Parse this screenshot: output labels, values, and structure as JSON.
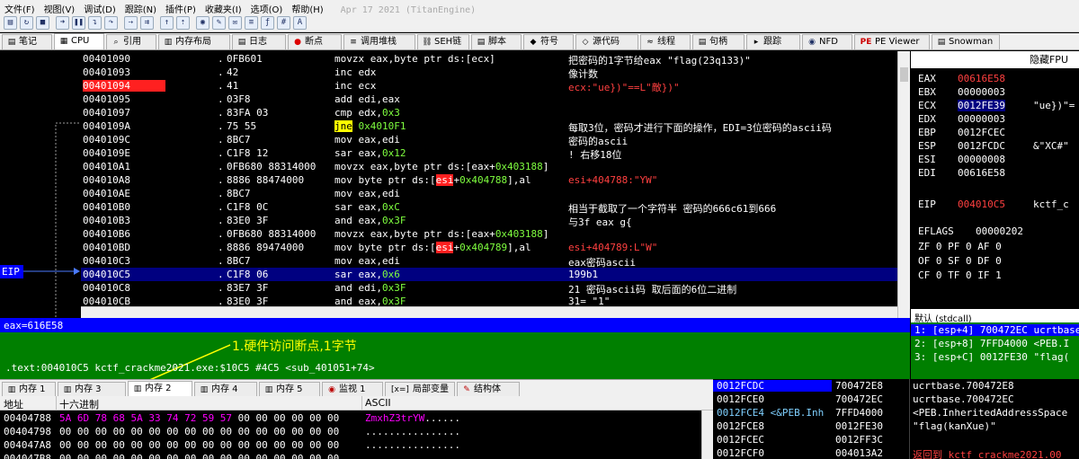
{
  "menu": [
    "文件(F)",
    "视图(V)",
    "调试(D)",
    "跟踪(N)",
    "插件(P)",
    "收藏夹(I)",
    "选项(O)",
    "帮助(H)",
    "Apr 17 2021 (TitanEngine)"
  ],
  "toolbar_icons": [
    "open-icon",
    "restart-icon",
    "close-icon",
    "run-icon",
    "pause-icon",
    "step-into-icon",
    "step-over-icon",
    "trace-into-icon",
    "trace-over-icon",
    "run-to-user-icon",
    "run-to-return-icon",
    "hide-icon",
    "patch-icon",
    "comment-icon",
    "label-icon",
    "function-icon",
    "hash-icon",
    "font-icon"
  ],
  "tabs": [
    {
      "label": "笔记",
      "icon": "▤"
    },
    {
      "label": "CPU",
      "icon": "▦"
    },
    {
      "label": "引用",
      "icon": "⌕"
    },
    {
      "label": "内存布局",
      "icon": "▥"
    },
    {
      "label": "日志",
      "icon": "▤"
    },
    {
      "label": "断点",
      "icon": "●"
    },
    {
      "label": "调用堆栈",
      "icon": "≡"
    },
    {
      "label": "SEH链",
      "icon": "⛓"
    },
    {
      "label": "脚本",
      "icon": "▤"
    },
    {
      "label": "符号",
      "icon": "◆"
    },
    {
      "label": "源代码",
      "icon": "◇"
    },
    {
      "label": "线程",
      "icon": "≈"
    },
    {
      "label": "句柄",
      "icon": "▤"
    },
    {
      "label": "跟踪",
      "icon": "▸"
    },
    {
      "label": "NFD",
      "icon": "◉"
    },
    {
      "label": "PE Viewer",
      "icon": "PE"
    },
    {
      "label": "Snowman",
      "icon": "▤"
    }
  ],
  "gutter": {
    "eip_label": "EIP"
  },
  "disasm": [
    {
      "addr": "00401090",
      "dot": ".",
      "hex": "0FB601",
      "asm": "movzx eax,byte ptr ds:[ecx]",
      "comment": "把密码的1字节给eax \"flag(23q133)\""
    },
    {
      "addr": "00401093",
      "dot": ".",
      "hex": "42",
      "asm": "inc edx",
      "comment": "像计数"
    },
    {
      "addr": "00401094",
      "dot": ".",
      "hex": "41",
      "asm": "inc ecx",
      "comment": "ecx:\"ue})\"==L\"敵})\"",
      "bp": true,
      "comment_color": "red"
    },
    {
      "addr": "00401095",
      "dot": ".",
      "hex": "03F8",
      "asm": "add edi,eax",
      "comment": ""
    },
    {
      "addr": "00401097",
      "dot": ".",
      "hex": "83FA 03",
      "asm": "cmp edx,0x3",
      "comment": ""
    },
    {
      "addr": "0040109A",
      "dot": ".",
      "hex": "75 55",
      "asm": "jne 0x4010F1",
      "comment": "每取3位，密码才进行下面的操作，EDI=3位密码的ascii码"
    },
    {
      "addr": "0040109C",
      "dot": ".",
      "hex": "8BC7",
      "asm": "mov eax,edi",
      "comment": "密码的ascii"
    },
    {
      "addr": "0040109E",
      "dot": ".",
      "hex": "C1F8 12",
      "asm": "sar eax,0x12",
      "comment": "! 右移18位"
    },
    {
      "addr": "004010A1",
      "dot": ".",
      "hex": "0FB680 88314000",
      "asm": "movzx eax,byte ptr ds:[eax+0x403188]",
      "comment": ""
    },
    {
      "addr": "004010A8",
      "dot": ".",
      "hex": "8886 88474000",
      "asm": "mov byte ptr ds:[esi+0x404788],al",
      "comment": "esi+404788:\"YW\"",
      "comment_color": "red"
    },
    {
      "addr": "004010AE",
      "dot": ".",
      "hex": "8BC7",
      "asm": "mov eax,edi",
      "comment": ""
    },
    {
      "addr": "004010B0",
      "dot": ".",
      "hex": "C1F8 0C",
      "asm": "sar eax,0xC",
      "comment": "相当于截取了一个字符半  密码的666c61到666"
    },
    {
      "addr": "004010B3",
      "dot": ".",
      "hex": "83E0 3F",
      "asm": "and eax,0x3F",
      "comment": "与3f  eax g{"
    },
    {
      "addr": "004010B6",
      "dot": ".",
      "hex": "0FB680 88314000",
      "asm": "movzx eax,byte ptr ds:[eax+0x403188]",
      "comment": ""
    },
    {
      "addr": "004010BD",
      "dot": ".",
      "hex": "8886 89474000",
      "asm": "mov byte ptr ds:[esi+0x404789],al",
      "comment": "esi+404789:L\"W\"",
      "comment_color": "red"
    },
    {
      "addr": "004010C3",
      "dot": ".",
      "hex": "8BC7",
      "asm": "mov eax,edi",
      "comment": "eax密码ascii"
    },
    {
      "addr": "004010C5",
      "dot": ".",
      "hex": "C1F8 06",
      "asm": "sar eax,0x6",
      "comment": "199b1",
      "selected": true
    },
    {
      "addr": "004010C8",
      "dot": ".",
      "hex": "83E7 3F",
      "asm": "and edi,0x3F",
      "comment": "21  密码ascii码  取后面的6位二进制"
    },
    {
      "addr": "004010CB",
      "dot": ".",
      "hex": "83E0 3F",
      "asm": "and eax,0x3F",
      "comment": "31= \"1\""
    }
  ],
  "registers": {
    "header": "隐藏FPU",
    "rows": [
      {
        "name": "EAX",
        "value": "00616E58",
        "comment": "",
        "value_color": "red"
      },
      {
        "name": "EBX",
        "value": "00000003",
        "comment": ""
      },
      {
        "name": "ECX",
        "value": "0012FE39",
        "comment": "\"ue})\"=",
        "selected": true
      },
      {
        "name": "EDX",
        "value": "00000003",
        "comment": ""
      },
      {
        "name": "EBP",
        "value": "0012FCEC",
        "comment": ""
      },
      {
        "name": "ESP",
        "value": "0012FCDC",
        "comment": "&\"XC#\""
      },
      {
        "name": "ESI",
        "value": "00000008",
        "comment": ""
      },
      {
        "name": "EDI",
        "value": "00616E58",
        "comment": ""
      },
      {
        "name": "EIP",
        "value": "004010C5",
        "comment": "kctf_c",
        "value_color": "red"
      },
      {
        "name": "EFLAGS",
        "value": "00000202",
        "comment": ""
      }
    ],
    "flags": [
      "ZF 0  PF 0  AF 0",
      "OF 0  SF 0  DF 0",
      "CF 0  TF 0  IF 1"
    ]
  },
  "info": {
    "line1": "eax=616E58",
    "module_line": ".text:004010C5 kctf_crackme2021.exe:$10C5 #4C5 <sub_401051+74>",
    "annotation": "1.硬件访问断点,1字节"
  },
  "stack_args": {
    "header": "默认 (stdcall)",
    "rows": [
      "1: [esp+4] 700472EC ucrtbase",
      "2: [esp+8] 7FFD4000 <PEB.I",
      "3: [esp+C] 0012FE30 \"flag("
    ]
  },
  "dump_tabs": [
    {
      "label": "内存 1",
      "icon": "▥"
    },
    {
      "label": "内存 3",
      "icon": "▥"
    },
    {
      "label": "内存 2",
      "icon": "▥"
    },
    {
      "label": "内存 4",
      "icon": "▥"
    },
    {
      "label": "内存 5",
      "icon": "▥"
    },
    {
      "label": "监视 1",
      "icon": "◉"
    },
    {
      "label": "局部变量",
      "icon": "[x=]"
    },
    {
      "label": "结构体",
      "icon": "✎"
    }
  ],
  "dump_header": {
    "addr": "地址",
    "hex": "十六进制",
    "ascii": "ASCII"
  },
  "dump_rows": [
    {
      "addr": "00404788",
      "hex_hl": "5A 6D 78 68 5A 33 74 72 59 57",
      "hex_rest": " 00 00 00 00 00 00",
      "ascii_hl": "ZmxhZ3trYW",
      "ascii_rest": "......"
    },
    {
      "addr": "00404798",
      "hex_hl": "",
      "hex_rest": "00 00 00 00 00 00 00 00 00 00 00 00 00 00 00 00",
      "ascii_hl": "",
      "ascii_rest": "................"
    },
    {
      "addr": "004047A8",
      "hex_hl": "",
      "hex_rest": "00 00 00 00 00 00 00 00 00 00 00 00 00 00 00 00",
      "ascii_hl": "",
      "ascii_rest": "................"
    },
    {
      "addr": "004047B8",
      "hex_hl": "",
      "hex_rest": "00 00 00 00 00 00 00 00 00 00 00 00 00 00 00 00",
      "ascii_hl": "",
      "ascii_rest": "................"
    }
  ],
  "stack_rows": [
    {
      "addr": "0012FCDC",
      "val": "700472E8",
      "comment": "ucrtbase.700472E8",
      "selected": true
    },
    {
      "addr": "0012FCE0",
      "val": "700472EC",
      "comment": "ucrtbase.700472EC"
    },
    {
      "addr": "0012FCE4 <&PEB.Inh",
      "val": "7FFD4000",
      "comment": "<PEB.InheritedAddressSpace",
      "addr_color": "cyan"
    },
    {
      "addr": "0012FCE8",
      "val": "0012FE30",
      "comment": "\"flag(kanXue)\""
    },
    {
      "addr": "0012FCEC",
      "val": "0012FF3C",
      "comment": ""
    },
    {
      "addr": "0012FCF0",
      "val": "004013A2",
      "comment": "返回到 kctf_crackme2021.00",
      "comment_color": "red"
    }
  ]
}
